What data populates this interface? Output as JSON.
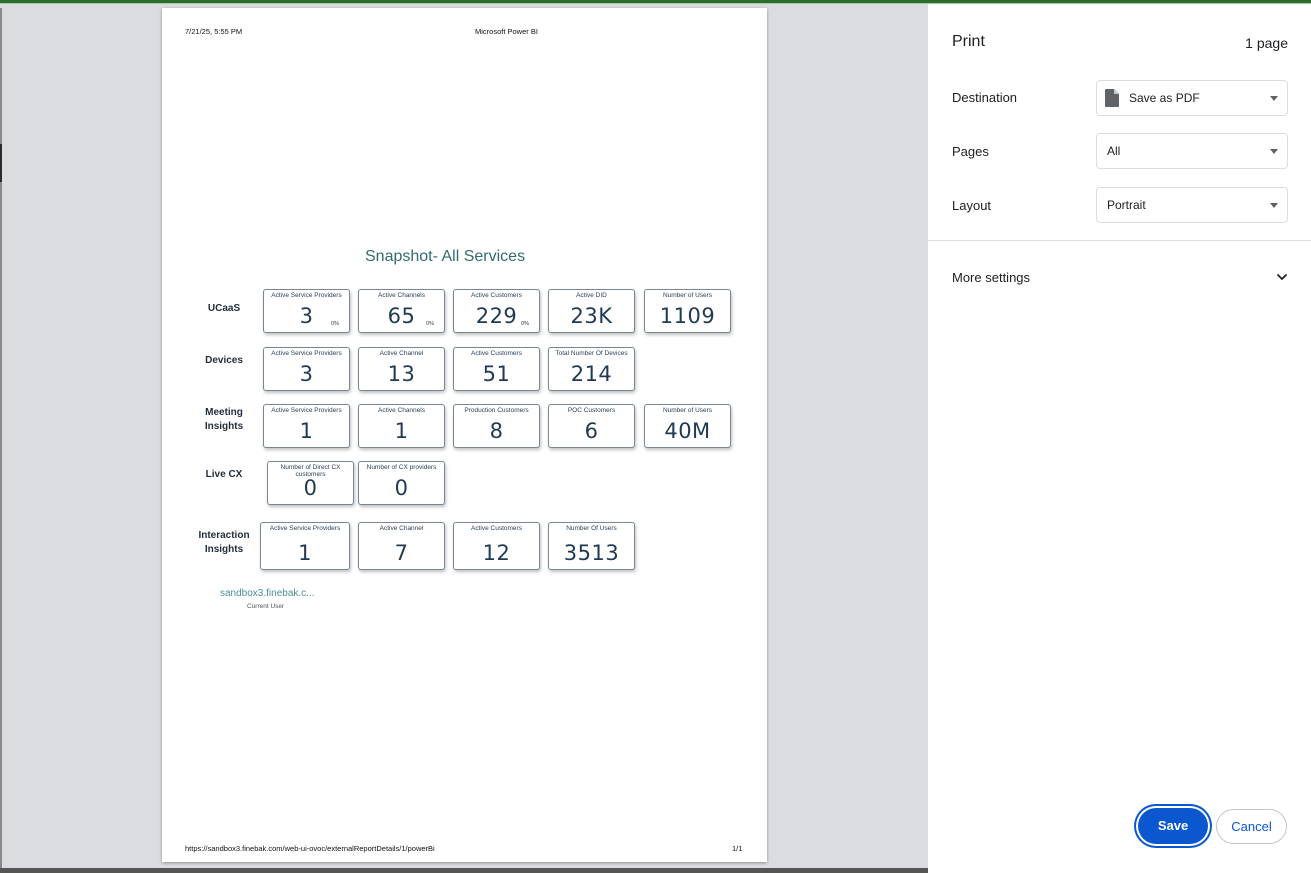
{
  "sheet": {
    "header_date": "7/21/25, 5:55 PM",
    "header_title": "Microsoft Power BI",
    "footer_url": "https://sandbox3.finebak.com/web-ui-ovoc/externalReportDetails/1/powerBi",
    "footer_page": "1/1",
    "report_title": "Snapshot- All Services",
    "rows": [
      {
        "label": "UCaaS",
        "cards": [
          {
            "title": "Active Service Providers",
            "value": "3",
            "pct": "0%"
          },
          {
            "title": "Active Channels",
            "value": "65",
            "pct": "0%"
          },
          {
            "title": "Active Customers",
            "value": "229",
            "pct": "0%"
          },
          {
            "title": "Active DID",
            "value": "23K"
          },
          {
            "title": "Number of Users",
            "value": "1109"
          }
        ]
      },
      {
        "label": "Devices",
        "cards": [
          {
            "title": "Active Service Providers",
            "value": "3"
          },
          {
            "title": "Active Channel",
            "value": "13"
          },
          {
            "title": "Active Customers",
            "value": "51"
          },
          {
            "title": "Total Number Of Devices",
            "value": "214"
          }
        ]
      },
      {
        "label": "Meeting Insights",
        "cards": [
          {
            "title": "Active Service Providers",
            "value": "1"
          },
          {
            "title": "Active Channels",
            "value": "1"
          },
          {
            "title": "Production Customers",
            "value": "8"
          },
          {
            "title": "POC Customers",
            "value": "6"
          },
          {
            "title": "Number of Users",
            "value": "40M"
          }
        ]
      },
      {
        "label": "Live CX",
        "cards": [
          {
            "title": "Number of Direct CX customers",
            "value": "0"
          },
          {
            "title": "Number of CX providers",
            "value": "0"
          }
        ]
      },
      {
        "label": "Interaction Insights",
        "cards": [
          {
            "title": "Active Service Providers",
            "value": "1"
          },
          {
            "title": "Active Channel",
            "value": "7"
          },
          {
            "title": "Active Customers",
            "value": "12"
          },
          {
            "title": "Number Of Users",
            "value": "3513"
          }
        ]
      }
    ],
    "current_user_value": "sandbox3.finebak.c...",
    "current_user_label": "Current User"
  },
  "panel": {
    "title": "Print",
    "page_count": "1 page",
    "destination_label": "Destination",
    "destination_value": "Save as PDF",
    "pages_label": "Pages",
    "pages_value": "All",
    "layout_label": "Layout",
    "layout_value": "Portrait",
    "more_settings": "More settings",
    "save_label": "Save",
    "cancel_label": "Cancel"
  },
  "icons": {
    "destination": "file-icon",
    "more_settings": "chevron-down-icon"
  },
  "colors": {
    "accent": "#0b57d0",
    "report_title": "#316b73",
    "card_value": "#1f3a52"
  }
}
